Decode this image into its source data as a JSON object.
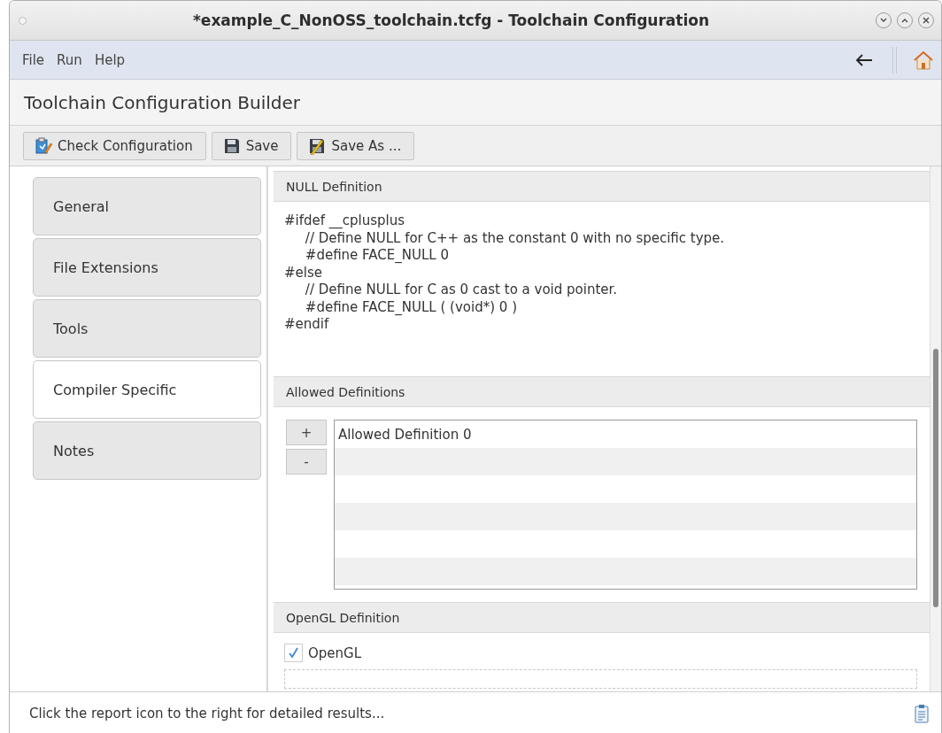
{
  "window": {
    "title": "*example_C_NonOSS_toolchain.tcfg - Toolchain Configuration"
  },
  "menu": [
    "File",
    "Run",
    "Help"
  ],
  "header": {
    "title": "Toolchain Configuration Builder"
  },
  "toolbar": [
    {
      "label": "Check Configuration",
      "kind": "check"
    },
    {
      "label": "Save",
      "kind": "save"
    },
    {
      "label": "Save As ...",
      "kind": "saveas"
    }
  ],
  "sidebar": {
    "items": [
      {
        "label": "General",
        "selected": false
      },
      {
        "label": "File Extensions",
        "selected": false
      },
      {
        "label": "Tools",
        "selected": false
      },
      {
        "label": "Compiler Specific",
        "selected": true
      },
      {
        "label": "Notes",
        "selected": false
      }
    ]
  },
  "null_definition": {
    "title": "NULL Definition",
    "code": "#ifdef __cplusplus\n\t// Define NULL for C++ as the constant 0 with no specific type.\n\t#define FACE_NULL 0\n#else\n\t// Define NULL for C as 0 cast to a void pointer.\n\t#define FACE_NULL ( (void*) 0 )\n#endif"
  },
  "allowed_definitions": {
    "title": "Allowed Definitions",
    "add_button": "+",
    "remove_button": "-",
    "items": [
      "Allowed Definition 0"
    ]
  },
  "opengl_definition": {
    "title": "OpenGL Definition",
    "checkbox": {
      "label": "OpenGL",
      "checked": true
    }
  },
  "status_bar": {
    "text": "Click the report icon to the right for detailed results..."
  }
}
